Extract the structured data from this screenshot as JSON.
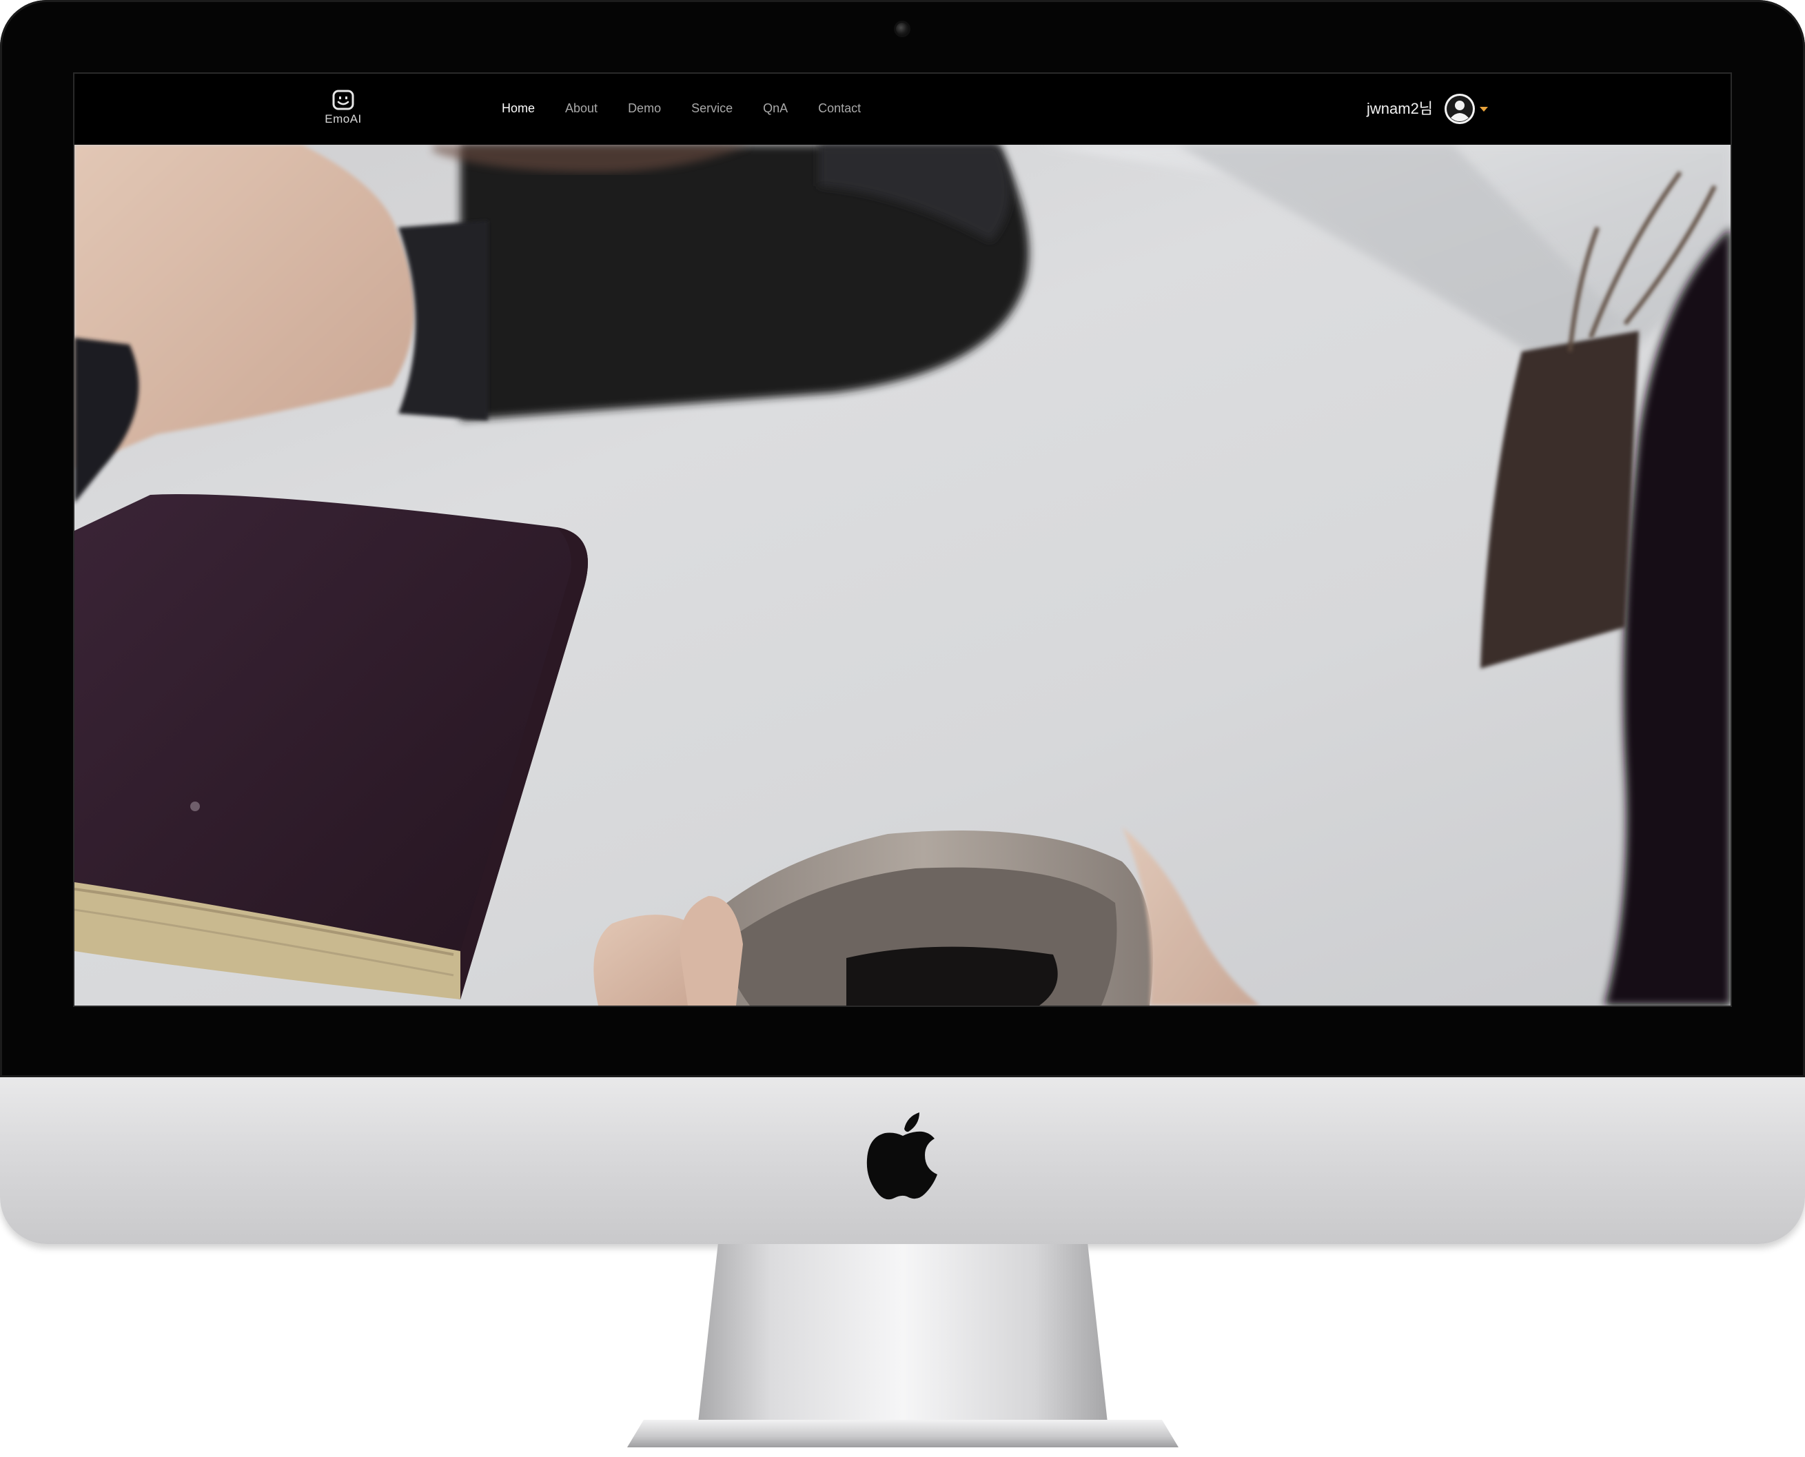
{
  "brand": {
    "name": "EmoAI",
    "icon": "smiley-box-icon"
  },
  "nav": {
    "items": [
      {
        "label": "Home",
        "active": true
      },
      {
        "label": "About",
        "active": false
      },
      {
        "label": "Demo",
        "active": false
      },
      {
        "label": "Service",
        "active": false
      },
      {
        "label": "QnA",
        "active": false
      },
      {
        "label": "Contact",
        "active": false
      }
    ]
  },
  "user": {
    "name": "jwnam2님",
    "avatar_icon": "user-avatar-icon",
    "dropdown_icon": "caret-down-icon",
    "caret_color": "#e8a23a"
  },
  "hero": {
    "image": "two-people-table-coffee-book-photo"
  },
  "colors": {
    "navbar_bg": "#000000",
    "nav_active": "#ffffff",
    "nav_inactive": "#a9a9a9"
  }
}
